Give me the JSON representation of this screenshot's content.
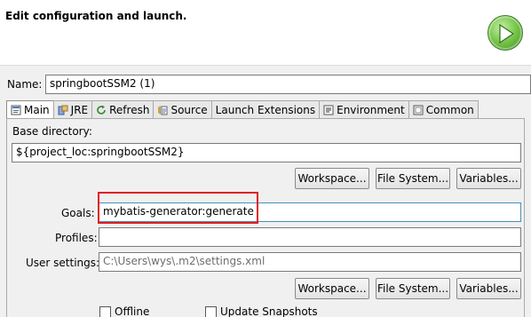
{
  "header": {
    "title": "Edit configuration and launch."
  },
  "name": {
    "label": "Name:",
    "value": "springbootSSM2 (1)"
  },
  "tabs": [
    {
      "label": "Main",
      "icon": "main-tab-icon",
      "active": true
    },
    {
      "label": "JRE",
      "icon": "jre-icon"
    },
    {
      "label": "Refresh",
      "icon": "refresh-icon"
    },
    {
      "label": "Source",
      "icon": "source-icon"
    },
    {
      "label": "Launch Extensions",
      "icon": ""
    },
    {
      "label": "Environment",
      "icon": "environment-icon"
    },
    {
      "label": "Common",
      "icon": "common-icon"
    }
  ],
  "main": {
    "base_dir_label": "Base directory:",
    "base_dir_value": "${project_loc:springbootSSM2}",
    "workspace_label": "Workspace...",
    "filesystem_label": "File System...",
    "variables_label": "Variables...",
    "goals_label": "Goals:",
    "goals_value": "mybatis-generator:generate",
    "profiles_label": "Profiles:",
    "profiles_value": "",
    "user_settings_label": "User settings:",
    "user_settings_value": "C:\\Users\\wys\\.m2\\settings.xml",
    "offline_label": "Offline",
    "update_snapshots_label": "Update Snapshots"
  },
  "colors": {
    "highlight": "#e02020",
    "launch_green": "#5aaf32"
  }
}
